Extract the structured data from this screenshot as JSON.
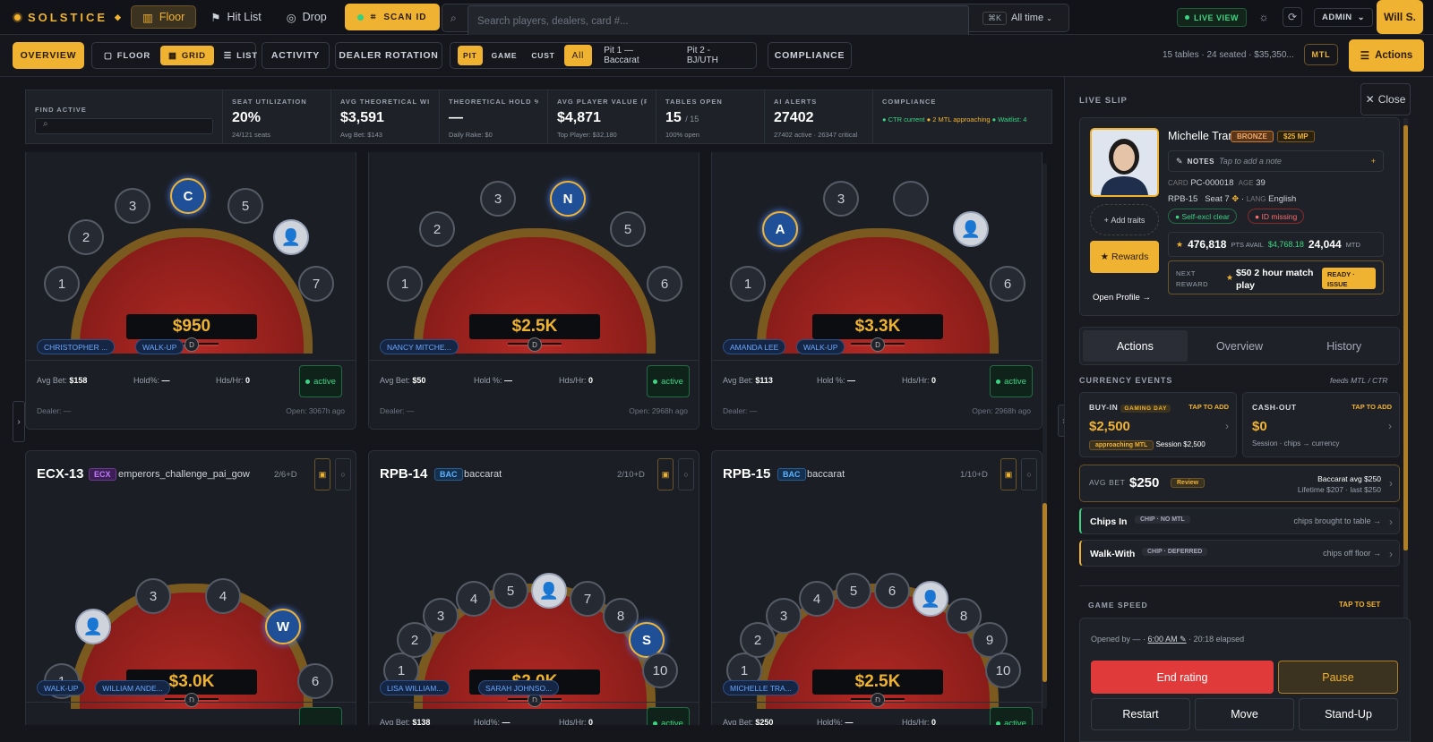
{
  "topbar": {
    "brand": "SOLSTICE",
    "nav": [
      "Floor",
      "Hit List",
      "Drop"
    ],
    "scan": "SCAN ID",
    "search_placeholder": "Search players, dealers, card #...",
    "kbd": "⌘K",
    "time": "All time",
    "live": "LIVE VIEW",
    "admin": "ADMIN",
    "user": "Will S."
  },
  "subbar": {
    "overview": "OVERVIEW",
    "floor": "FLOOR",
    "grid": "GRID",
    "list": "LIST",
    "activity": "ACTIVITY",
    "dealer_rotation": "DEALER ROTATION",
    "pit": "PIT",
    "game": "GAME",
    "cust": "CUST",
    "all": "All",
    "pit1": "Pit 1 — Baccarat",
    "pit2": "Pit 2 - BJ/UTH",
    "compliance": "COMPLIANCE",
    "summary": "15 tables · 24 seated · $35,350...",
    "mtl": "MTL",
    "actions": "Actions"
  },
  "kpis": [
    {
      "l": "FIND ACTIVE",
      "v": "",
      "s": ""
    },
    {
      "l": "SEAT UTILIZATION",
      "v": "20%",
      "s": "24/121 seats",
      "c": "#f0b331"
    },
    {
      "l": "AVG THEORETICAL WIN",
      "v": "$3,591",
      "s": "Avg Bet: $143",
      "c": "#ffffff"
    },
    {
      "l": "THEORETICAL HOLD %",
      "v": "—",
      "s": "Daily Rake: $0",
      "c": "#ffffff"
    },
    {
      "l": "AVG PLAYER VALUE (PL...",
      "v": "$4,871",
      "s": "Top Player: $32,180",
      "c": "#f0b331"
    },
    {
      "l": "TABLES OPEN",
      "v": "15",
      "v2": "/ 15",
      "s": "100% open",
      "c": "#ffffff"
    },
    {
      "l": "AI ALERTS",
      "v": "27402",
      "s": "27402 active · 26347 critical",
      "c": "#f0b331"
    },
    {
      "l": "COMPLIANCE",
      "s1": "CTR current",
      "s2": "2 MTL approaching",
      "s3": "Waitlist: 4"
    }
  ],
  "tables": [
    {
      "amount": "$950",
      "pills": [
        "CHRISTOPHER ...",
        "WALK-UP"
      ],
      "avg": "$158",
      "hold_l": "Hold%:",
      "hold": "—",
      "hds": "0",
      "status": "active",
      "dealer": "Dealer: —",
      "open": "Open: 3067h ago",
      "seats": [
        "1",
        "2",
        "3",
        "C",
        "5",
        "",
        "7"
      ]
    },
    {
      "amount": "$2.5K",
      "pills": [
        "NANCY MITCHE..."
      ],
      "avg": "$50",
      "hold_l": "Hold %:",
      "hold": "—",
      "hds": "0",
      "status": "active",
      "dealer": "Dealer: —",
      "open": "Open: 2968h ago",
      "seats": [
        "1",
        "2",
        "3",
        "N",
        "5",
        "6"
      ]
    },
    {
      "amount": "$3.3K",
      "pills": [
        "AMANDA LEE",
        "WALK-UP"
      ],
      "avg": "$113",
      "hold_l": "Hold %:",
      "hold": "—",
      "hds": "0",
      "status": "active",
      "dealer": "Dealer: —",
      "open": "Open: 2968h ago",
      "seats": [
        "1",
        "A",
        "3",
        "",
        "5",
        "6"
      ]
    },
    {
      "id": "ECX-13",
      "tag": "ECX",
      "game": "emperors_challenge_pai_gow",
      "count": "2/6+D",
      "amount": "$3.0K",
      "pills": [
        "WALK-UP",
        "WILLIAM ANDE..."
      ],
      "seats": [
        "1",
        "",
        "3",
        "4",
        "W",
        "6"
      ]
    },
    {
      "id": "RPB-14",
      "tag": "BAC",
      "game": "baccarat",
      "count": "2/10+D",
      "amount": "$2.0K",
      "pills": [
        "LISA WILLIAM...",
        "SARAH JOHNSO..."
      ],
      "avg": "$138",
      "hold_l": "Hold%:",
      "hold": "—",
      "hds": "0",
      "status": "active",
      "seats": [
        "1",
        "2",
        "3",
        "4",
        "5",
        "",
        "7",
        "8",
        "S",
        "10"
      ]
    },
    {
      "id": "RPB-15",
      "tag": "BAC",
      "game": "baccarat",
      "count": "1/10+D",
      "amount": "$2.5K",
      "pills": [
        "MICHELLE TRA..."
      ],
      "avg": "$250",
      "hold_l": "Hold%:",
      "hold": "—",
      "hds": "0",
      "status": "active",
      "seats": [
        "1",
        "2",
        "3",
        "4",
        "5",
        "6",
        "",
        "8",
        "9",
        "10"
      ]
    }
  ],
  "labels": {
    "avg": "Avg Bet:",
    "hds": "Hds/Hr:",
    "d": "D"
  },
  "panel": {
    "title": "LIVE SLIP",
    "close": "Close",
    "name": "Michelle Tran",
    "tier": "BRONZE",
    "mp": "$25 MP",
    "notes_l": "NOTES",
    "notes": "Tap to add a note",
    "card_l": "CARD",
    "card": "PC-000018",
    "age_l": "AGE",
    "age": "39",
    "table": "RPB-15",
    "seat": "Seat 7",
    "lang_l": "LANG",
    "lang": "English",
    "add_traits": "Add traits",
    "selfexcl": "Self-excl clear",
    "idmissing": "ID missing",
    "rewards": "Rewards",
    "points": "476,818",
    "pts_l": "PTS AVAIL",
    "pts_val": "$4,768.18",
    "mtd": "24,044",
    "mtd_l": "MTD",
    "open_profile": "Open  Profile →",
    "next_l1": "NEXT",
    "next_l2": "REWARD",
    "next": "$50 2 hour match play",
    "ready": "READY · ISSUE",
    "tabs": [
      "Actions",
      "Overview",
      "History"
    ],
    "currency": "CURRENCY EVENTS",
    "feeds": "feeds MTL / CTR",
    "buyin_l": "BUY-IN",
    "gaming_day": "GAMING DAY",
    "tap_add": "TAP TO ADD",
    "buyin": "$2,500",
    "mtl_chip": "approaching MTL",
    "session": "Session $2,500",
    "cashout_l": "CASH-OUT",
    "cashout": "$0",
    "cashout_sub": "Session · chips → currency",
    "avgbet_l": "AVG BET",
    "avgbet": "$250",
    "review": "Review",
    "bac_avg": "Baccarat avg $250",
    "lifetime": "Lifetime $207 · last $250",
    "chipsin": "Chips In",
    "chipsin_tag": "CHIP · NO MTL",
    "chipsin_desc": "chips brought to table →",
    "walkwith": "Walk-With",
    "walkwith_tag": "CHIP · DEFERRED",
    "walkwith_desc": "chips off floor →",
    "speed": "GAME SPEED",
    "tap_set": "TAP TO SET",
    "opened": "Opened by — ·",
    "opened_time": "6:00 AM ✎",
    "elapsed": "· 20:18 elapsed",
    "end": "End rating",
    "pause": "Pause",
    "restart": "Restart",
    "move": "Move",
    "standup": "Stand-Up"
  },
  "colors": {
    "accent": "#f0b331",
    "green": "#3bd683",
    "felt": "#a3221f"
  }
}
